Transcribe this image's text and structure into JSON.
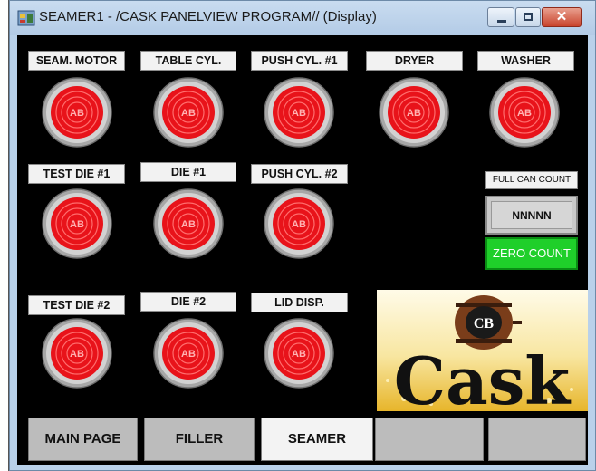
{
  "window": {
    "title": "SEAMER1 - /CASK PANELVIEW PROGRAM// (Display)",
    "close_glyph": "✕"
  },
  "lights": [
    {
      "label": "SEAM. MOTOR",
      "badge": "AB"
    },
    {
      "label": "TABLE CYL.",
      "badge": "AB"
    },
    {
      "label": "PUSH CYL. #1",
      "badge": "AB"
    },
    {
      "label": "DRYER",
      "badge": "AB"
    },
    {
      "label": "WASHER",
      "badge": "AB"
    },
    {
      "label": "TEST DIE #1",
      "badge": "AB"
    },
    {
      "label": "DIE #1",
      "badge": "AB"
    },
    {
      "label": "PUSH CYL. #2",
      "badge": "AB"
    },
    {
      "label": "TEST DIE #2",
      "badge": "AB"
    },
    {
      "label": "DIE #2",
      "badge": "AB"
    },
    {
      "label": "LID DISP.",
      "badge": "AB"
    }
  ],
  "counter": {
    "label": "FULL CAN COUNT",
    "value": "NNNNN",
    "zero_button": "ZERO COUNT"
  },
  "logo": {
    "word": "Cask",
    "badge": "CB"
  },
  "nav": [
    {
      "label": "MAIN PAGE"
    },
    {
      "label": "FILLER"
    },
    {
      "label": "SEAMER"
    },
    {
      "label": ""
    },
    {
      "label": ""
    }
  ],
  "colors": {
    "indicator_red": "#e8131a",
    "zero_button_green": "#1fcf2a",
    "background": "#000000"
  }
}
